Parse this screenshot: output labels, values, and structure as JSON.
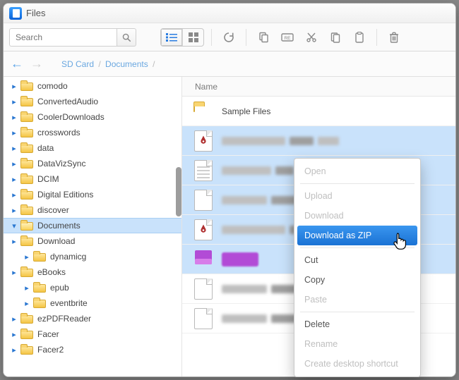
{
  "app": {
    "title": "Files"
  },
  "toolbar": {
    "search_placeholder": "Search"
  },
  "breadcrumb": {
    "segments": [
      "SD Card",
      "Documents"
    ]
  },
  "sidebar": {
    "items": [
      {
        "label": "comodo",
        "depth": 1
      },
      {
        "label": "ConvertedAudio",
        "depth": 1
      },
      {
        "label": "CoolerDownloads",
        "depth": 1
      },
      {
        "label": "crosswords",
        "depth": 1
      },
      {
        "label": "data",
        "depth": 1
      },
      {
        "label": "DataVizSync",
        "depth": 1
      },
      {
        "label": "DCIM",
        "depth": 1
      },
      {
        "label": "Digital Editions",
        "depth": 1
      },
      {
        "label": "discover",
        "depth": 1
      },
      {
        "label": "Documents",
        "depth": 1,
        "selected": true,
        "open": true
      },
      {
        "label": "Download",
        "depth": 1
      },
      {
        "label": "dynamicg",
        "depth": 2
      },
      {
        "label": "eBooks",
        "depth": 1
      },
      {
        "label": "epub",
        "depth": 2
      },
      {
        "label": "eventbrite",
        "depth": 2
      },
      {
        "label": "ezPDFReader",
        "depth": 1
      },
      {
        "label": "Facer",
        "depth": 1
      },
      {
        "label": "Facer2",
        "depth": 1
      }
    ]
  },
  "content": {
    "column_header": "Name",
    "rows": [
      {
        "type": "folder",
        "name": "Sample Files",
        "selected": false
      },
      {
        "type": "pdf",
        "selected": true
      },
      {
        "type": "text",
        "selected": true
      },
      {
        "type": "blank",
        "selected": true
      },
      {
        "type": "pdf",
        "selected": true
      },
      {
        "type": "image-purple",
        "selected": true
      },
      {
        "type": "blank",
        "selected": false
      },
      {
        "type": "blank",
        "selected": false
      }
    ]
  },
  "context_menu": {
    "items": [
      {
        "label": "Open",
        "disabled": true
      },
      {
        "sep": true
      },
      {
        "label": "Upload",
        "disabled": true
      },
      {
        "label": "Download",
        "disabled": true
      },
      {
        "label": "Download as ZIP",
        "hovered": true
      },
      {
        "sep": true
      },
      {
        "label": "Cut"
      },
      {
        "label": "Copy"
      },
      {
        "label": "Paste",
        "disabled": true
      },
      {
        "sep": true
      },
      {
        "label": "Delete"
      },
      {
        "label": "Rename",
        "disabled": true
      },
      {
        "label": "Create desktop shortcut",
        "disabled": true
      }
    ]
  }
}
